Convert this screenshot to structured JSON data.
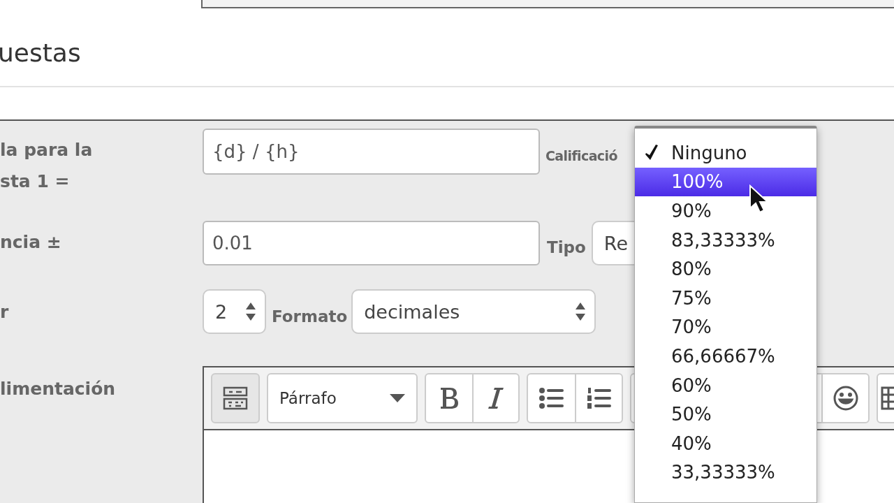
{
  "section": {
    "title": "uestas"
  },
  "answer_formula": {
    "label": "la para la\nsta 1 =",
    "value": "{d} / {h}",
    "grade_label": "Calificació"
  },
  "tolerance": {
    "label": "ncia ±",
    "value": "0.01",
    "type_label": "Tipo",
    "type_value": "Re"
  },
  "display": {
    "label": "r",
    "decimals": "2",
    "format_label": "Formato",
    "format_value": "decimales"
  },
  "feedback": {
    "label": "limentación",
    "paragraph_style": "Párrafo"
  },
  "grade_menu": {
    "items": [
      {
        "label": "Ninguno",
        "checked": true,
        "highlighted": false
      },
      {
        "label": "100%",
        "checked": false,
        "highlighted": true
      },
      {
        "label": "90%",
        "checked": false,
        "highlighted": false
      },
      {
        "label": "83,33333%",
        "checked": false,
        "highlighted": false
      },
      {
        "label": "80%",
        "checked": false,
        "highlighted": false
      },
      {
        "label": "75%",
        "checked": false,
        "highlighted": false
      },
      {
        "label": "70%",
        "checked": false,
        "highlighted": false
      },
      {
        "label": "66,66667%",
        "checked": false,
        "highlighted": false
      },
      {
        "label": "60%",
        "checked": false,
        "highlighted": false
      },
      {
        "label": "50%",
        "checked": false,
        "highlighted": false
      },
      {
        "label": "40%",
        "checked": false,
        "highlighted": false
      },
      {
        "label": "33,33333%",
        "checked": false,
        "highlighted": false
      }
    ]
  }
}
